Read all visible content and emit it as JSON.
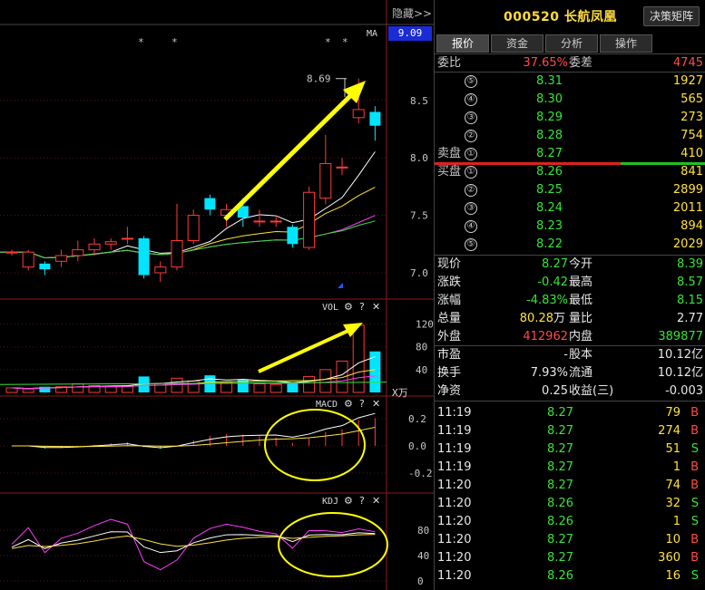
{
  "header": {
    "hide_label": "隐藏>>",
    "ma_label": "MA",
    "current_price_box": "9.09"
  },
  "main_chart": {
    "y_ticks": [
      "8.5",
      "8.0",
      "7.5",
      "7.0"
    ],
    "annotation": "8.69",
    "star_marks": [
      "*",
      "*",
      "*",
      "*"
    ]
  },
  "vol_pane": {
    "label": "VOL",
    "y_ticks": [
      "120",
      "80",
      "40"
    ],
    "unit": "X万"
  },
  "macd_pane": {
    "label": "MACD",
    "y_ticks": [
      "0.2",
      "0.0",
      "-0.2"
    ]
  },
  "kdj_pane": {
    "label": "KDJ",
    "y_ticks": [
      "80",
      "40",
      "0"
    ]
  },
  "pane_controls": {
    "gear": "⚙",
    "help": "?",
    "close": "✕"
  },
  "panel": {
    "stock_code": "000520 长航凤凰",
    "decision_button": "决策矩阵",
    "tabs": [
      "报价",
      "资金",
      "分析",
      "操作"
    ],
    "wei_bi_label": "委比",
    "wei_bi_value": "37.65%",
    "wei_cha_label": "委差",
    "wei_cha_value": "4745",
    "sell_label": "卖盘",
    "buy_label": "买盘",
    "sell_orders": [
      {
        "level": "⑤",
        "price": "8.31",
        "volume": "1927"
      },
      {
        "level": "④",
        "price": "8.30",
        "volume": "565"
      },
      {
        "level": "③",
        "price": "8.29",
        "volume": "273"
      },
      {
        "level": "②",
        "price": "8.28",
        "volume": "754"
      },
      {
        "level": "①",
        "price": "8.27",
        "volume": "410"
      }
    ],
    "buy_orders": [
      {
        "level": "①",
        "price": "8.26",
        "volume": "841"
      },
      {
        "level": "②",
        "price": "8.25",
        "volume": "2899"
      },
      {
        "level": "③",
        "price": "8.24",
        "volume": "2011"
      },
      {
        "level": "④",
        "price": "8.23",
        "volume": "894"
      },
      {
        "level": "⑤",
        "price": "8.22",
        "volume": "2029"
      }
    ],
    "stats": [
      {
        "l1": "现价",
        "v1": "8.27",
        "c1": "green",
        "l2": "今开",
        "v2": "8.39",
        "c2": "green"
      },
      {
        "l1": "涨跌",
        "v1": "-0.42",
        "c1": "green",
        "l2": "最高",
        "v2": "8.57",
        "c2": "green"
      },
      {
        "l1": "涨幅",
        "v1": "-4.83%",
        "c1": "green",
        "l2": "最低",
        "v2": "8.15",
        "c2": "green"
      },
      {
        "l1": "总量",
        "v1": "80.28",
        "c1": "yellow",
        "u1": "万",
        "l2": "量比",
        "v2": "2.77",
        "c2": "white"
      },
      {
        "l1": "外盘",
        "v1": "412962",
        "c1": "red",
        "l2": "内盘",
        "v2": "389877",
        "c2": "green"
      },
      {
        "l1": "市盈",
        "v1": "-",
        "c1": "white",
        "l2": "股本",
        "v2": "10.12亿",
        "c2": "white"
      },
      {
        "l1": "换手",
        "v1": "7.93%",
        "c1": "white",
        "l2": "流通",
        "v2": "10.12亿",
        "c2": "white"
      },
      {
        "l1": "净资",
        "v1": "0.25",
        "c1": "white",
        "l2": "收益(三)",
        "v2": "-0.003",
        "c2": "white"
      }
    ],
    "ticks": [
      {
        "time": "11:19",
        "price": "8.27",
        "vol": "79",
        "dir": "B"
      },
      {
        "time": "11:19",
        "price": "8.27",
        "vol": "274",
        "dir": "B"
      },
      {
        "time": "11:19",
        "price": "8.27",
        "vol": "51",
        "dir": "S"
      },
      {
        "time": "11:19",
        "price": "8.27",
        "vol": "1",
        "dir": "B"
      },
      {
        "time": "11:20",
        "price": "8.27",
        "vol": "74",
        "dir": "B"
      },
      {
        "time": "11:20",
        "price": "8.26",
        "vol": "32",
        "dir": "S"
      },
      {
        "time": "11:20",
        "price": "8.26",
        "vol": "1",
        "dir": "S"
      },
      {
        "time": "11:20",
        "price": "8.27",
        "vol": "10",
        "dir": "B"
      },
      {
        "time": "11:20",
        "price": "8.27",
        "vol": "360",
        "dir": "B"
      },
      {
        "time": "11:20",
        "price": "8.26",
        "vol": "16",
        "dir": "S"
      }
    ]
  },
  "chart_data": {
    "type": "candlestick",
    "candles": [
      {
        "o": 7.18,
        "c": 7.18,
        "h": 7.2,
        "l": 7.15
      },
      {
        "o": 7.05,
        "c": 7.18,
        "h": 7.2,
        "l": 7.02
      },
      {
        "o": 7.08,
        "c": 7.03,
        "h": 7.1,
        "l": 6.98
      },
      {
        "o": 7.1,
        "c": 7.15,
        "h": 7.2,
        "l": 7.05
      },
      {
        "o": 7.15,
        "c": 7.2,
        "h": 7.28,
        "l": 7.1
      },
      {
        "o": 7.2,
        "c": 7.25,
        "h": 7.3,
        "l": 7.15
      },
      {
        "o": 7.25,
        "c": 7.27,
        "h": 7.3,
        "l": 7.2
      },
      {
        "o": 7.3,
        "c": 7.3,
        "h": 7.4,
        "l": 7.25
      },
      {
        "o": 7.3,
        "c": 6.98,
        "h": 7.32,
        "l": 6.95
      },
      {
        "o": 7.0,
        "c": 7.05,
        "h": 7.1,
        "l": 6.92
      },
      {
        "o": 7.05,
        "c": 7.28,
        "h": 7.6,
        "l": 7.02
      },
      {
        "o": 7.28,
        "c": 7.5,
        "h": 7.55,
        "l": 7.25
      },
      {
        "o": 7.65,
        "c": 7.55,
        "h": 7.68,
        "l": 7.5
      },
      {
        "o": 7.5,
        "c": 7.55,
        "h": 7.6,
        "l": 7.4
      },
      {
        "o": 7.58,
        "c": 7.48,
        "h": 7.65,
        "l": 7.4
      },
      {
        "o": 7.45,
        "c": 7.45,
        "h": 7.55,
        "l": 7.4
      },
      {
        "o": 7.45,
        "c": 7.45,
        "h": 7.5,
        "l": 7.4
      },
      {
        "o": 7.4,
        "c": 7.25,
        "h": 7.42,
        "l": 7.22
      },
      {
        "o": 7.22,
        "c": 7.7,
        "h": 7.75,
        "l": 7.2
      },
      {
        "o": 7.65,
        "c": 7.95,
        "h": 8.2,
        "l": 7.6
      },
      {
        "o": 7.92,
        "c": 7.92,
        "h": 8.0,
        "l": 7.85
      },
      {
        "o": 8.35,
        "c": 8.42,
        "h": 8.69,
        "l": 8.3
      },
      {
        "o": 8.4,
        "c": 8.28,
        "h": 8.45,
        "l": 8.15
      }
    ],
    "volume": [
      8,
      6,
      10,
      10,
      15,
      12,
      10,
      12,
      28,
      16,
      25,
      20,
      30,
      18,
      22,
      15,
      14,
      18,
      28,
      40,
      55,
      118,
      72
    ],
    "y_range": [
      6.85,
      9.09
    ],
    "vol_range": [
      0,
      140
    ]
  }
}
